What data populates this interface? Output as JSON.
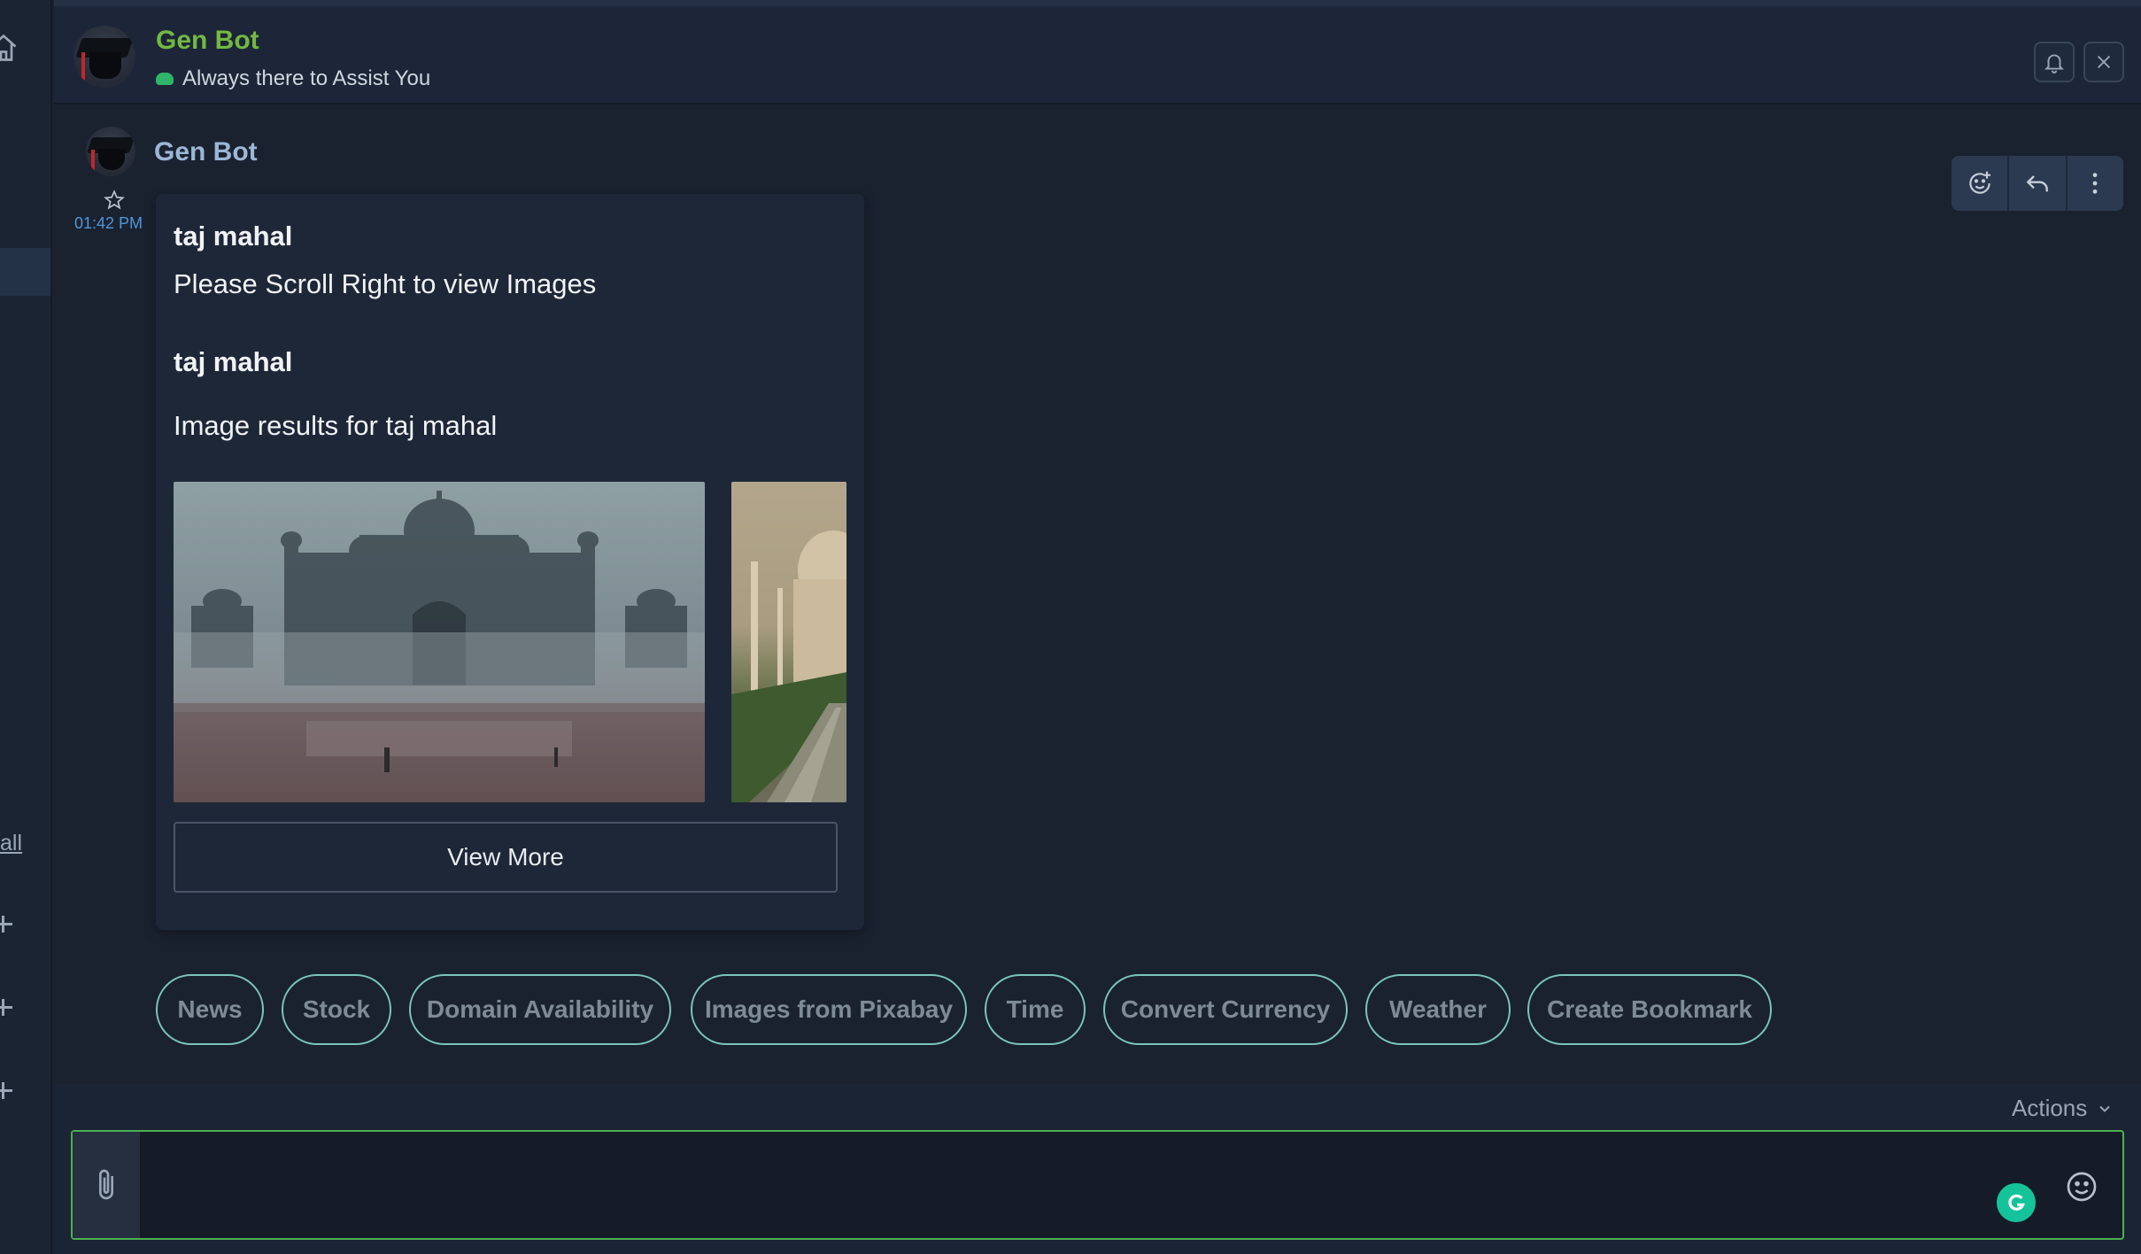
{
  "header": {
    "bot_name": "Gen Bot",
    "status_text": "Always there to Assist You",
    "icons": {
      "home": "home-icon",
      "bell": "bell-icon",
      "close": "close-icon"
    }
  },
  "sidebar": {
    "all_link": "all"
  },
  "message": {
    "sender": "Gen Bot",
    "time": "01:42 PM",
    "title1": "taj mahal",
    "line1": "Please Scroll Right to view Images",
    "title2": "taj mahal",
    "line2": "Image results for taj mahal",
    "view_more": "View More",
    "action_icons": [
      "emoji-reaction-icon",
      "reply-icon",
      "more-options-icon"
    ]
  },
  "quick_replies": [
    "News",
    "Stock",
    "Domain Availability",
    "Images from Pixabay",
    "Time",
    "Convert Currency",
    "Weather",
    "Create Bookmark"
  ],
  "composer": {
    "actions_label": "Actions",
    "input_value": "",
    "icons": [
      "paperclip-icon",
      "grammarly-icon",
      "emoji-icon"
    ]
  },
  "colors": {
    "bot_name_green": "#74b841",
    "chip_border": "#7cc5bb",
    "composer_border": "#4caf50",
    "time_blue": "#4f96d6"
  }
}
